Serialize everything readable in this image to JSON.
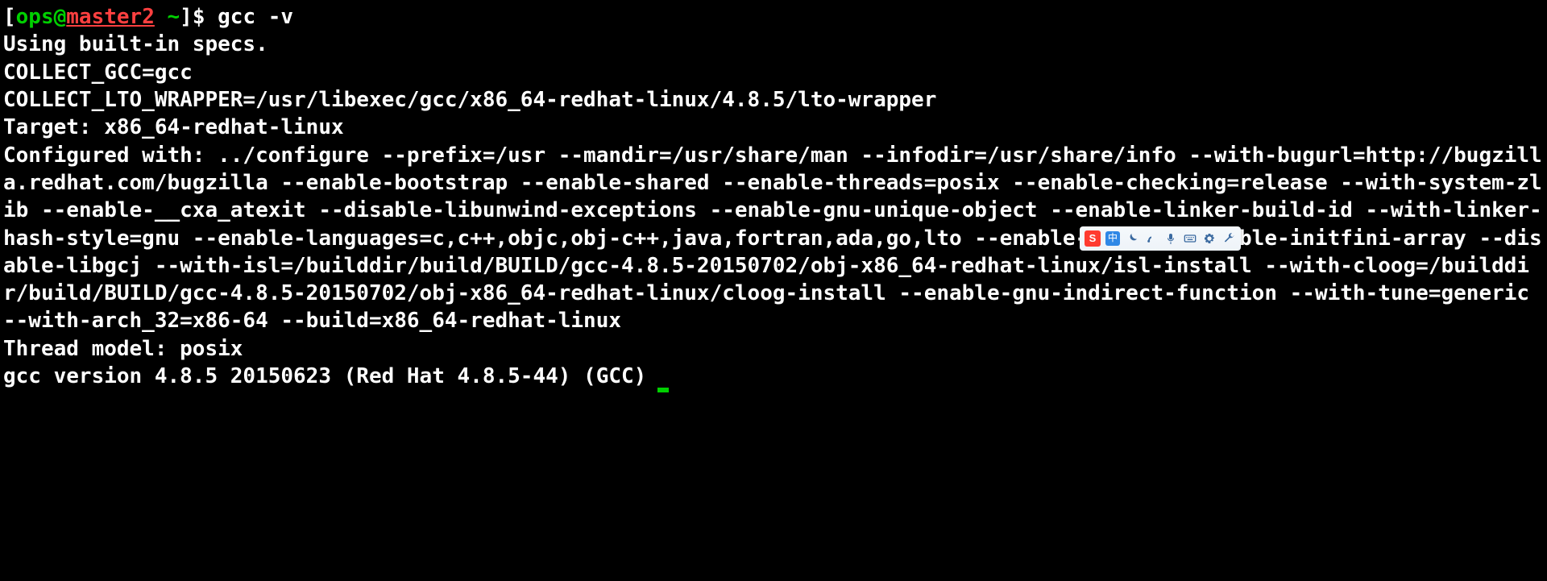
{
  "prompt": {
    "open": "[",
    "user": "ops",
    "at": "@",
    "host": "master2",
    "sep": " ",
    "path": "~",
    "close": "]",
    "sigil": "$",
    "trailing_space": " "
  },
  "command": "gcc -v",
  "output": "Using built-in specs.\nCOLLECT_GCC=gcc\nCOLLECT_LTO_WRAPPER=/usr/libexec/gcc/x86_64-redhat-linux/4.8.5/lto-wrapper\nTarget: x86_64-redhat-linux\nConfigured with: ../configure --prefix=/usr --mandir=/usr/share/man --infodir=/usr/share/info --with-bugurl=http://bugzilla.redhat.com/bugzilla --enable-bootstrap --enable-shared --enable-threads=posix --enable-checking=release --with-system-zlib --enable-__cxa_atexit --disable-libunwind-exceptions --enable-gnu-unique-object --enable-linker-build-id --with-linker-hash-style=gnu --enable-languages=c,c++,objc,obj-c++,java,fortran,ada,go,lto --enable-plugin --enable-initfini-array --disable-libgcj --with-isl=/builddir/build/BUILD/gcc-4.8.5-20150702/obj-x86_64-redhat-linux/isl-install --with-cloog=/builddir/build/BUILD/gcc-4.8.5-20150702/obj-x86_64-redhat-linux/cloog-install --enable-gnu-indirect-function --with-tune=generic --with-arch_32=x86-64 --build=x86_64-redhat-linux\nThread model: posix\ngcc version 4.8.5 20150623 (Red Hat 4.8.5-44) (GCC) ",
  "ime": {
    "logo": "S",
    "zh": "中",
    "icons": [
      "moon",
      "punct",
      "mic",
      "keyboard",
      "gear",
      "wrench"
    ]
  }
}
